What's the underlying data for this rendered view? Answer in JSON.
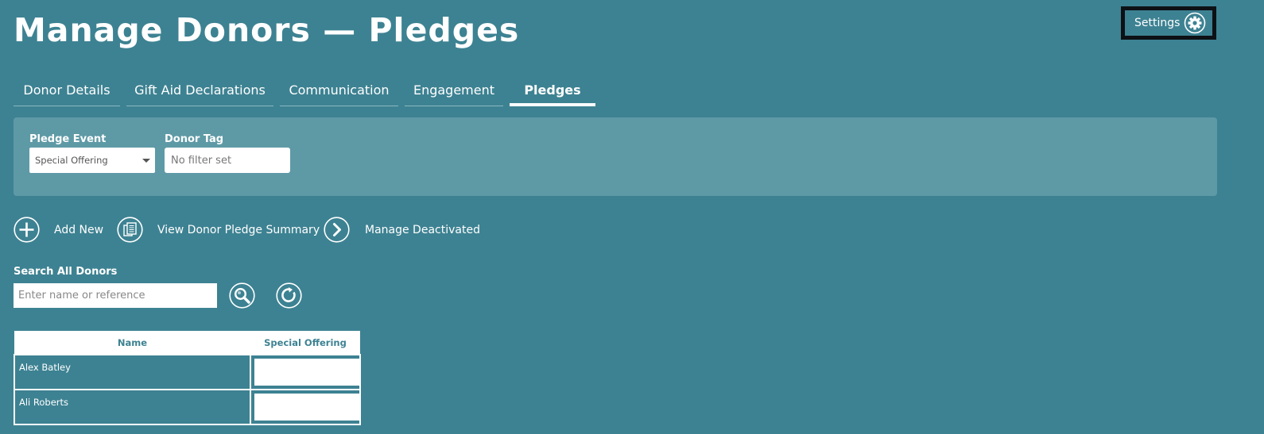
{
  "header": {
    "title": "Manage Donors — Pledges"
  },
  "settings": {
    "label": "Settings",
    "icon": "gear-icon"
  },
  "tabs": [
    {
      "label": "Donor Details",
      "active": false
    },
    {
      "label": "Gift Aid Declarations",
      "active": false
    },
    {
      "label": "Communication",
      "active": false
    },
    {
      "label": "Engagement",
      "active": false
    },
    {
      "label": "Pledges",
      "active": true
    }
  ],
  "filters": {
    "pledge_event": {
      "label": "Pledge Event",
      "value": "Special Offering"
    },
    "donor_tag": {
      "label": "Donor Tag",
      "placeholder": "No filter set"
    }
  },
  "actions": {
    "add_new": "Add New",
    "view_summary": "View Donor Pledge Summary",
    "manage_deactivated": "Manage Deactivated"
  },
  "search": {
    "label": "Search All Donors",
    "placeholder": "Enter name or reference"
  },
  "table": {
    "columns": [
      "Name",
      "Special Offering"
    ],
    "rows": [
      {
        "name": "Alex Batley",
        "amount": ""
      },
      {
        "name": "Ali Roberts",
        "amount": ""
      }
    ]
  },
  "colors": {
    "background": "#3d8292",
    "panel": "#5e9aa6",
    "settings_border": "#0d1115"
  }
}
